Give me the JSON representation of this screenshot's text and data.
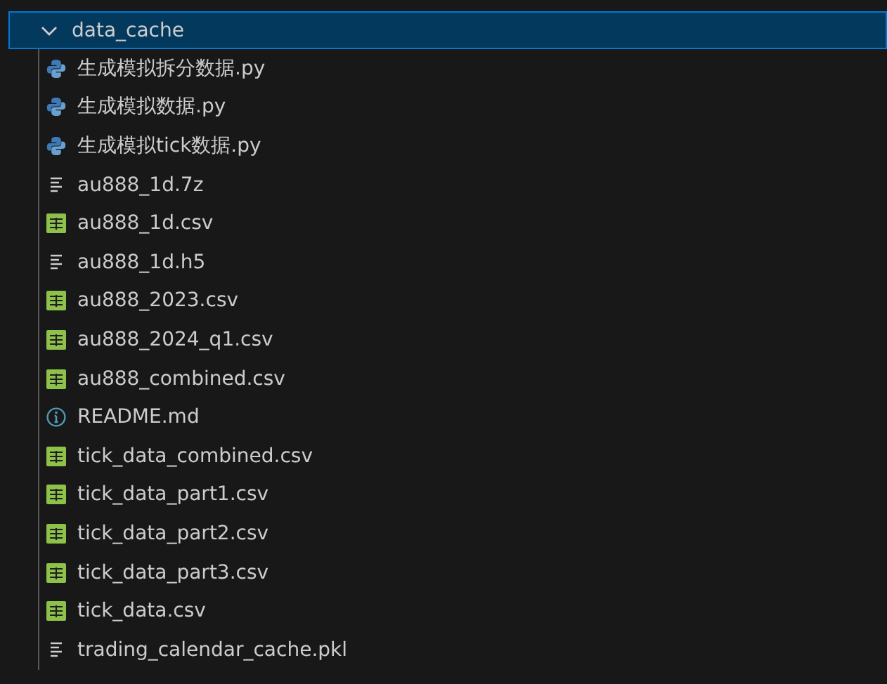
{
  "folder": {
    "name": "data_cache",
    "expanded": true,
    "selected": true,
    "children": [
      {
        "name": "生成模拟拆分数据.py",
        "kind": "python"
      },
      {
        "name": "生成模拟数据.py",
        "kind": "python"
      },
      {
        "name": "生成模拟tick数据.py",
        "kind": "python"
      },
      {
        "name": "au888_1d.7z",
        "kind": "text"
      },
      {
        "name": "au888_1d.csv",
        "kind": "csv"
      },
      {
        "name": "au888_1d.h5",
        "kind": "text"
      },
      {
        "name": "au888_2023.csv",
        "kind": "csv"
      },
      {
        "name": "au888_2024_q1.csv",
        "kind": "csv"
      },
      {
        "name": "au888_combined.csv",
        "kind": "csv"
      },
      {
        "name": "README.md",
        "kind": "info"
      },
      {
        "name": "tick_data_combined.csv",
        "kind": "csv"
      },
      {
        "name": "tick_data_part1.csv",
        "kind": "csv"
      },
      {
        "name": "tick_data_part2.csv",
        "kind": "csv"
      },
      {
        "name": "tick_data_part3.csv",
        "kind": "csv"
      },
      {
        "name": "tick_data.csv",
        "kind": "csv"
      },
      {
        "name": "trading_calendar_cache.pkl",
        "kind": "text"
      }
    ]
  }
}
